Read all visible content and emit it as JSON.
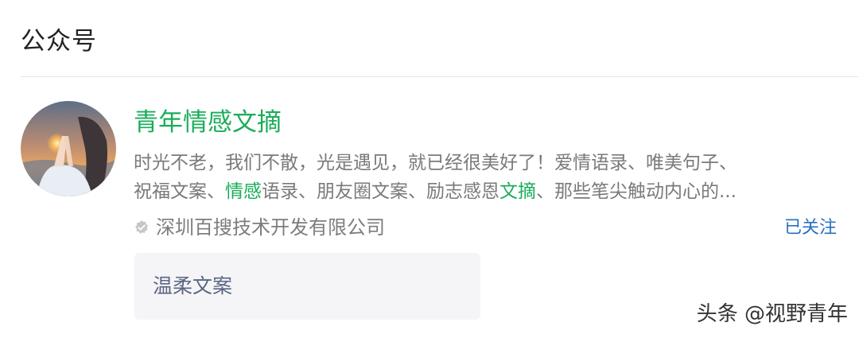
{
  "section": {
    "title": "公众号"
  },
  "account": {
    "name": "青年情感文摘",
    "description": {
      "line1": "时光不老，我们不散，光是遇见，就已经很美好了！爱情语录、唯美句子、",
      "line2_a": "祝福文案、",
      "line2_hl1": "情感",
      "line2_b": "语录、朋友圈文案、励志感恩",
      "line2_hl2": "文摘",
      "line2_c": "、那些笔尖触动内心的..."
    },
    "company": "深圳百搜技术开发有限公司",
    "verified_icon": "verified-badge-icon",
    "follow_status": "已关注"
  },
  "article": {
    "title": "温柔文案"
  },
  "watermark": {
    "text": "头条 @视野青年"
  },
  "colors": {
    "accent_green": "#1aad5a",
    "link_blue": "#2a6fc2",
    "text_gray": "#7a7a7a",
    "card_bg": "#f5f5f7"
  }
}
